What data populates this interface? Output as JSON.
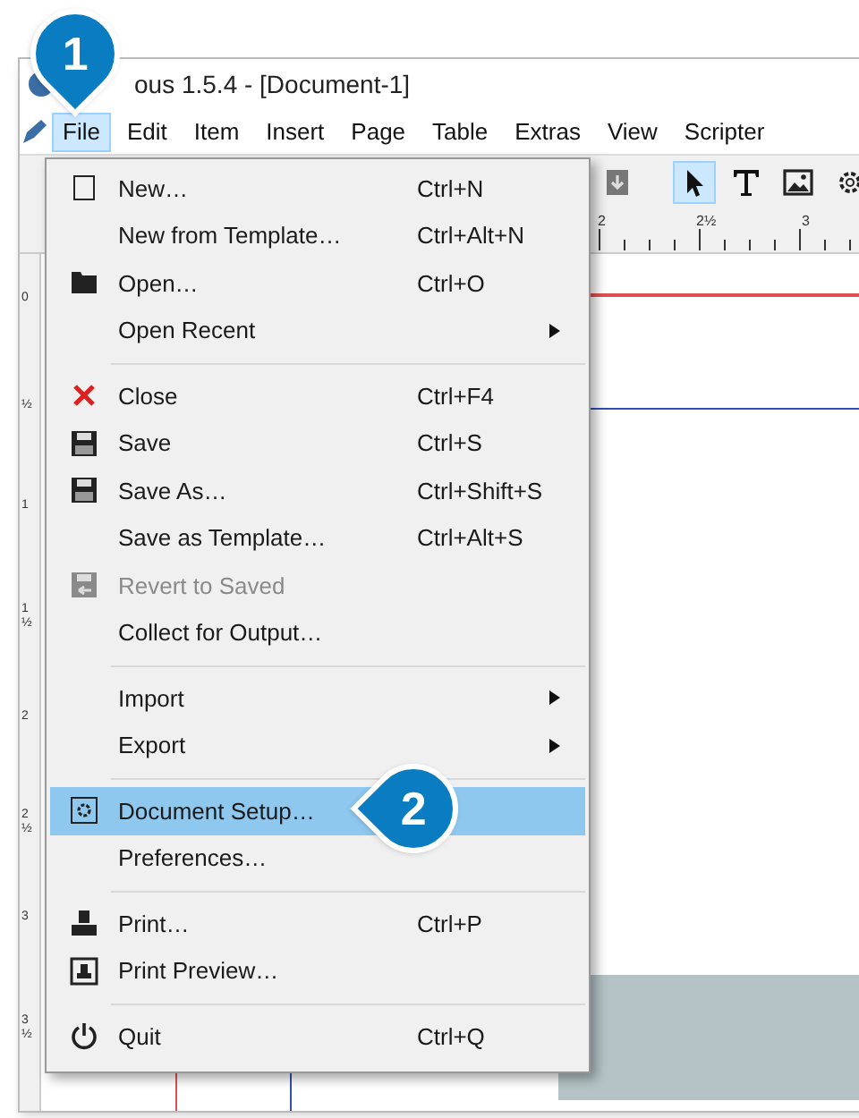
{
  "window": {
    "title": "ous 1.5.4 - [Document-1]"
  },
  "menubar": [
    {
      "label": "File",
      "selected": true
    },
    {
      "label": "Edit",
      "selected": false
    },
    {
      "label": "Item",
      "selected": false
    },
    {
      "label": "Insert",
      "selected": false
    },
    {
      "label": "Page",
      "selected": false
    },
    {
      "label": "Table",
      "selected": false
    },
    {
      "label": "Extras",
      "selected": false
    },
    {
      "label": "View",
      "selected": false
    },
    {
      "label": "Scripter",
      "selected": false
    }
  ],
  "tools": [
    {
      "selected": false
    },
    {
      "selected": true
    },
    {
      "selected": false
    },
    {
      "selected": false
    },
    {
      "selected": false
    }
  ],
  "top_ruler": [
    "2",
    "2½",
    "3"
  ],
  "left_ruler": [
    "0",
    "½",
    "1",
    "1½",
    "2",
    "2½",
    "3",
    "3½"
  ],
  "file_menu": [
    {
      "kind": "item",
      "label": "New…",
      "shortcut": "Ctrl+N",
      "disabled": false,
      "selected": false,
      "submenu": false
    },
    {
      "kind": "item",
      "label": "New from Template…",
      "shortcut": "Ctrl+Alt+N",
      "disabled": false,
      "selected": false,
      "submenu": false
    },
    {
      "kind": "item",
      "label": "Open…",
      "shortcut": "Ctrl+O",
      "disabled": false,
      "selected": false,
      "submenu": false
    },
    {
      "kind": "item",
      "label": "Open Recent",
      "disabled": false,
      "selected": false,
      "submenu": true
    },
    {
      "kind": "separator"
    },
    {
      "kind": "item",
      "label": "Close",
      "shortcut": "Ctrl+F4",
      "disabled": false,
      "selected": false,
      "submenu": false
    },
    {
      "kind": "item",
      "label": "Save",
      "shortcut": "Ctrl+S",
      "disabled": false,
      "selected": false,
      "submenu": false
    },
    {
      "kind": "item",
      "label": "Save As…",
      "shortcut": "Ctrl+Shift+S",
      "disabled": false,
      "selected": false,
      "submenu": false
    },
    {
      "kind": "item",
      "label": "Save as Template…",
      "shortcut": "Ctrl+Alt+S",
      "disabled": false,
      "selected": false,
      "submenu": false
    },
    {
      "kind": "item",
      "label": "Revert to Saved",
      "disabled": true,
      "selected": false,
      "submenu": false
    },
    {
      "kind": "item",
      "label": "Collect for Output…",
      "disabled": false,
      "selected": false,
      "submenu": false
    },
    {
      "kind": "separator"
    },
    {
      "kind": "item",
      "label": "Import",
      "disabled": false,
      "selected": false,
      "submenu": true
    },
    {
      "kind": "item",
      "label": "Export",
      "disabled": false,
      "selected": false,
      "submenu": true
    },
    {
      "kind": "separator"
    },
    {
      "kind": "item",
      "label": "Document Setup…",
      "disabled": false,
      "selected": true,
      "submenu": false
    },
    {
      "kind": "item",
      "label": "Preferences…",
      "disabled": false,
      "selected": false,
      "submenu": false
    },
    {
      "kind": "separator"
    },
    {
      "kind": "item",
      "label": "Print…",
      "shortcut": "Ctrl+P",
      "disabled": false,
      "selected": false,
      "submenu": false
    },
    {
      "kind": "item",
      "label": "Print Preview…",
      "disabled": false,
      "selected": false,
      "submenu": false
    },
    {
      "kind": "separator"
    },
    {
      "kind": "item",
      "label": "Quit",
      "shortcut": "Ctrl+Q",
      "disabled": false,
      "selected": false,
      "submenu": false
    }
  ],
  "badges": [
    {
      "text": "1"
    },
    {
      "text": "2"
    }
  ]
}
